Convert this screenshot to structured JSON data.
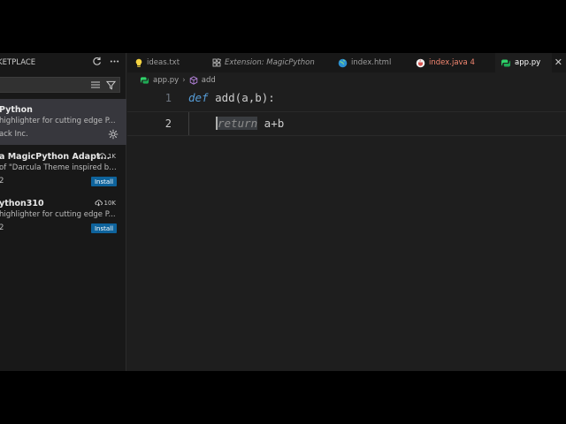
{
  "sidebar": {
    "title": "KETPLACE",
    "extensions": [
      {
        "name": "Python",
        "description": "highlighter for cutting edge P...",
        "publisher": "ack Inc.",
        "selected": true
      },
      {
        "name": "a MagicPython Adapt...",
        "description": "of \"Darcula Theme inspired by ...",
        "publisher": "2",
        "downloads": "1K",
        "install_label": "Install"
      },
      {
        "name": "ython310",
        "description": "highlighter for cutting edge P...",
        "publisher": "2",
        "downloads": "10K",
        "install_label": "Install"
      }
    ]
  },
  "tabs": [
    {
      "label": "ideas.txt",
      "icon": "lightbulb-icon"
    },
    {
      "label": "Extension: MagicPython",
      "icon": "extension-icon",
      "italic": true
    },
    {
      "label": "index.html",
      "icon": "globe-icon"
    },
    {
      "label": "index.java 4",
      "icon": "java-icon",
      "error": true
    },
    {
      "label": "app.py",
      "icon": "python-icon",
      "active": true
    }
  ],
  "breadcrumb": {
    "file": "app.py",
    "symbol": "add"
  },
  "editor": {
    "lines": [
      {
        "number": "1",
        "keyword": "def",
        "rest": " add(a,b):"
      },
      {
        "number": "2",
        "keyword": "return",
        "rest": " a+b"
      }
    ]
  },
  "colors": {
    "accent": "#0e639c",
    "keyword": "#569cd6",
    "error_tab": "#f48771",
    "python_icon": "#2fd36a"
  }
}
